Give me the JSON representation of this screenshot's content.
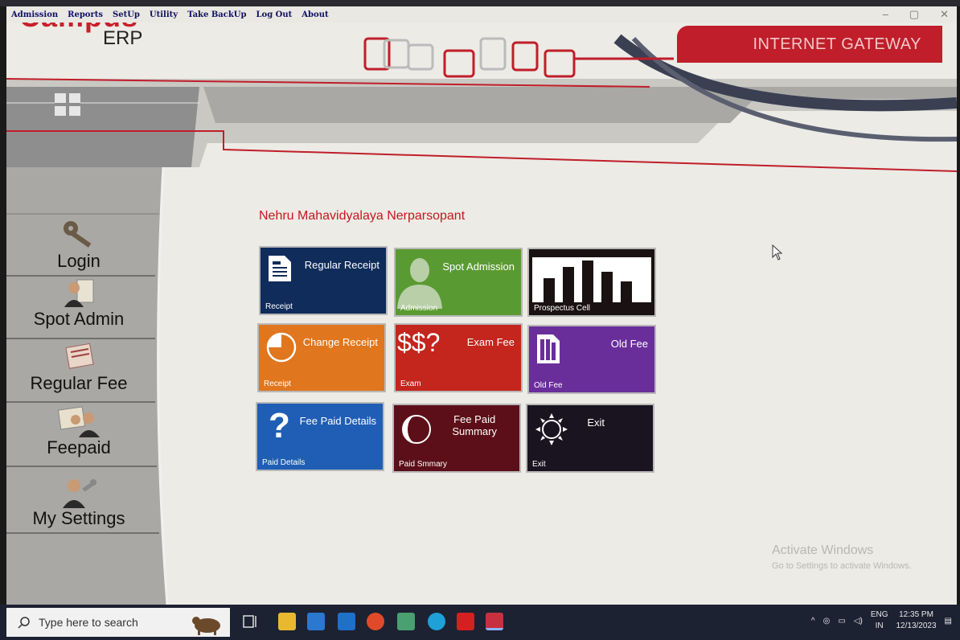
{
  "menu": [
    "Admission",
    "Reports",
    "SetUp",
    "Utility",
    "Take BackUp",
    "Log Out",
    "About"
  ],
  "window_controls": [
    "–",
    "▢",
    "✕"
  ],
  "logo": {
    "campus": "Campus",
    "erp": "ERP"
  },
  "gateway": "INTERNET GATEWAY",
  "org_title": "Nehru Mahavidyalaya Nerparsopant",
  "nav": [
    {
      "label": "Login",
      "icon": "key-icon"
    },
    {
      "label": "Spot Admin",
      "icon": "person-document-icon"
    },
    {
      "label": "Regular Fee",
      "icon": "fee-document-icon"
    },
    {
      "label": "Feepaid",
      "icon": "people-document-icon"
    },
    {
      "label": "My Settings",
      "icon": "settings-person-icon"
    }
  ],
  "tiles": [
    {
      "title": "Regular Receipt",
      "sub": "Receipt",
      "color": "#0f2c5a",
      "icon": "document-icon"
    },
    {
      "title": "Spot Admission",
      "sub": "Admission",
      "color": "#5a9a32",
      "icon": "person-silhouette-icon"
    },
    {
      "title": "",
      "sub": "Prospectus Cell",
      "color": "#1a1212",
      "icon": "bar-chart-icon"
    },
    {
      "title": "Change Receipt",
      "sub": "Receipt",
      "color": "#e0761e",
      "icon": "pie-chart-icon"
    },
    {
      "title": "Exam Fee",
      "sub": "Exam",
      "color": "#c4251c",
      "icon": "dollar-question-icon",
      "glyph": "$$?"
    },
    {
      "title": "Old Fee",
      "sub": "Old Fee",
      "color": "#6a2e9a",
      "icon": "document-lines-icon"
    },
    {
      "title": "Fee Paid Details",
      "sub": "Paid Details",
      "color": "#1f5eb4",
      "icon": "question-mark-icon",
      "glyph": "?"
    },
    {
      "title": "Fee Paid\nSummary",
      "sub": "Paid Smmary",
      "color": "#5c0f18",
      "icon": "crescent-icon"
    },
    {
      "title": "Exit",
      "sub": "Exit",
      "color": "#1a1420",
      "icon": "sun-icon"
    }
  ],
  "activate": {
    "line1": "Activate Windows",
    "line2": "Go to Settings to activate Windows."
  },
  "taskbar": {
    "search_placeholder": "Type here to search",
    "lang": "ENG",
    "region": "IN",
    "time": "12:35 PM",
    "date": "12/13/2023"
  },
  "colors": {
    "brand_red": "#c8202a",
    "title_red": "#c8161e"
  }
}
